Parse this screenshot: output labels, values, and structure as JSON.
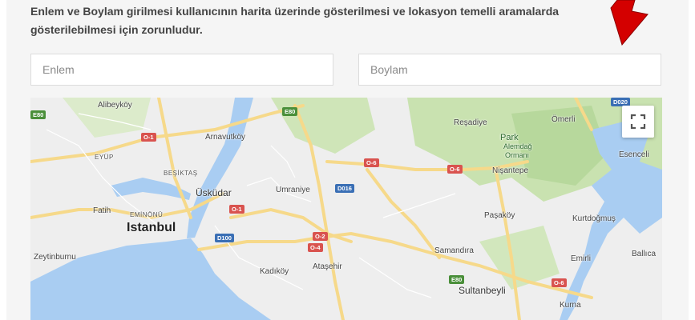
{
  "form": {
    "description": "Enlem ve Boylam girilmesi kullanıcının harita üzerinde gösterilmesi ve lokasyon temelli aramalarda gösterilebilmesi için zorunludur.",
    "latitude_placeholder": "Enlem",
    "longitude_placeholder": "Boylam"
  },
  "map": {
    "fullscreen_icon": "fullscreen-icon",
    "labels": {
      "alibeykoy": "Alibeyköy",
      "arnavutkoy": "Arnavutköy",
      "eyup": "EYÜP",
      "besiktas": "BEŞİKTAŞ",
      "uskudar": "Üsküdar",
      "fatih": "Fatih",
      "eminonu": "EMİNÖNÜ",
      "istanbul": "Istanbul",
      "zeytinburnu": "Zeytinburnu",
      "kadikoy": "Kadıköy",
      "umraniye": "Umraniye",
      "atasehir": "Ataşehir",
      "samandira": "Samandıra",
      "sultanbeyli": "Sultanbeyli",
      "resadiye": "Reşadiye",
      "park": "Park",
      "alemdag": "Alemdağ",
      "ormani": "Ormanı",
      "nisantepe": "Nişantepe",
      "pasakoy": "Paşaköy",
      "omerli": "Ömerli",
      "esenceli": "Esenceli",
      "kurtdogmus": "Kurtdoğmuş",
      "emirli": "Emirli",
      "ballica": "Ballıca",
      "kurna": "Kurna"
    },
    "roads": {
      "e80_a": "E80",
      "e80_b": "E80",
      "e80_c": "E80",
      "o1_a": "O-1",
      "o1_b": "O-1",
      "o6_a": "O-6",
      "o6_b": "O-6",
      "o6_c": "O-6",
      "o2": "O-2",
      "o4": "O-4",
      "d016": "D016",
      "d100": "D100",
      "d020": "D020",
      "e_left": "E80"
    }
  }
}
